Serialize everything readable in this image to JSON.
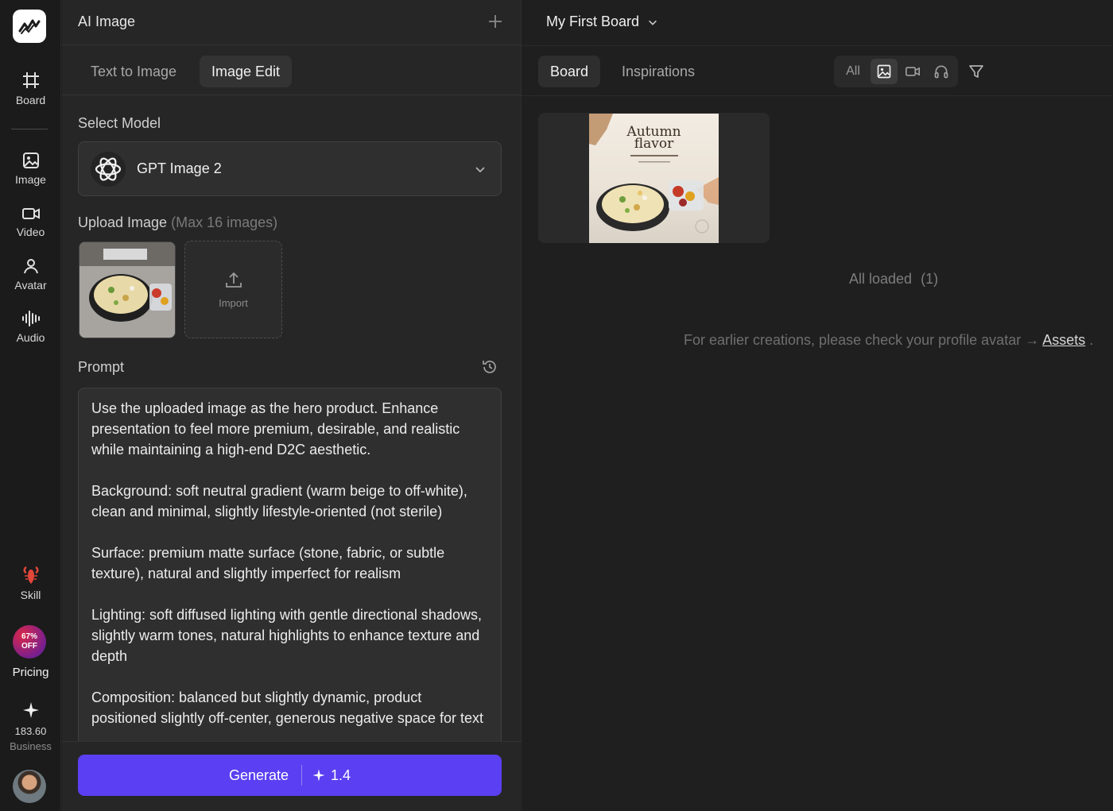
{
  "rail": {
    "items": [
      {
        "label": "Board"
      },
      {
        "label": "Image"
      },
      {
        "label": "Video"
      },
      {
        "label": "Avatar"
      },
      {
        "label": "Audio"
      },
      {
        "label": "Skill"
      }
    ],
    "promo": {
      "line1": "67%",
      "line2": "OFF",
      "label": "Pricing"
    },
    "credits": {
      "value": "183.60",
      "plan": "Business"
    }
  },
  "panel": {
    "title": "AI Image",
    "tabs": [
      {
        "label": "Text to Image",
        "active": false
      },
      {
        "label": "Image Edit",
        "active": true
      }
    ],
    "model": {
      "label": "Select Model",
      "value": "GPT Image 2"
    },
    "upload": {
      "label": "Upload Image",
      "hint": "(Max 16 images)",
      "import_label": "Import"
    },
    "prompt": {
      "label": "Prompt",
      "text": "Use the uploaded image as the hero product. Enhance presentation to feel more premium, desirable, and realistic while maintaining a high-end D2C aesthetic.\n\nBackground: soft neutral gradient (warm beige to off-white), clean and minimal, slightly lifestyle-oriented (not sterile)\n\nSurface: premium matte surface (stone, fabric, or subtle texture), natural and slightly imperfect for realism\n\nLighting: soft diffused lighting with gentle directional shadows, slightly warm tones, natural highlights to enhance texture and depth\n\nComposition: balanced but slightly dynamic, product positioned slightly off-center, generous negative space for text"
    },
    "generate": {
      "label": "Generate",
      "cost": "1.4"
    }
  },
  "board": {
    "title": "My First Board",
    "tabs": [
      {
        "label": "Board",
        "active": true
      },
      {
        "label": "Inspirations",
        "active": false
      }
    ],
    "filter": {
      "all_label": "All",
      "active": "image"
    },
    "card": {
      "poster_title_1": "Autumn",
      "poster_title_2": "flavor"
    },
    "status": "All loaded",
    "count": "(1)",
    "earlier_text": "For earlier creations, please check your profile avatar →",
    "assets_link": "Assets",
    "trailing": "."
  },
  "colors": {
    "accent": "#5b3ff2",
    "background": "#1f1f1f",
    "panel": "#262626"
  }
}
